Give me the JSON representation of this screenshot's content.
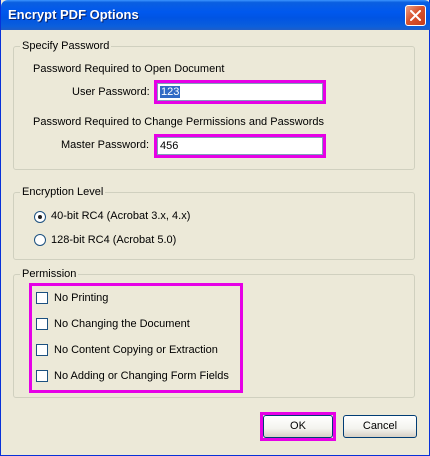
{
  "window": {
    "title": "Encrypt PDF Options"
  },
  "password_group": {
    "legend": "Specify Password",
    "open_heading": "Password Required to Open Document",
    "user_label": "User Password:",
    "user_value": "123",
    "perm_heading": "Password Required to Change Permissions and Passwords",
    "master_label": "Master Password:",
    "master_value": "456"
  },
  "encryption_group": {
    "legend": "Encryption Level",
    "options": [
      {
        "label": "40-bit RC4 (Acrobat 3.x, 4.x)",
        "selected": true
      },
      {
        "label": "128-bit RC4 (Acrobat 5.0)",
        "selected": false
      }
    ]
  },
  "permission_group": {
    "legend": "Permission",
    "options": [
      {
        "label": "No Printing",
        "checked": false
      },
      {
        "label": "No Changing the Document",
        "checked": false
      },
      {
        "label": "No Content Copying or Extraction",
        "checked": false
      },
      {
        "label": "No Adding or Changing Form Fields",
        "checked": false
      }
    ]
  },
  "buttons": {
    "ok": "OK",
    "cancel": "Cancel"
  },
  "colors": {
    "highlight": "#e600e6",
    "titlebar": "#0054e3",
    "face": "#ece9d8"
  }
}
